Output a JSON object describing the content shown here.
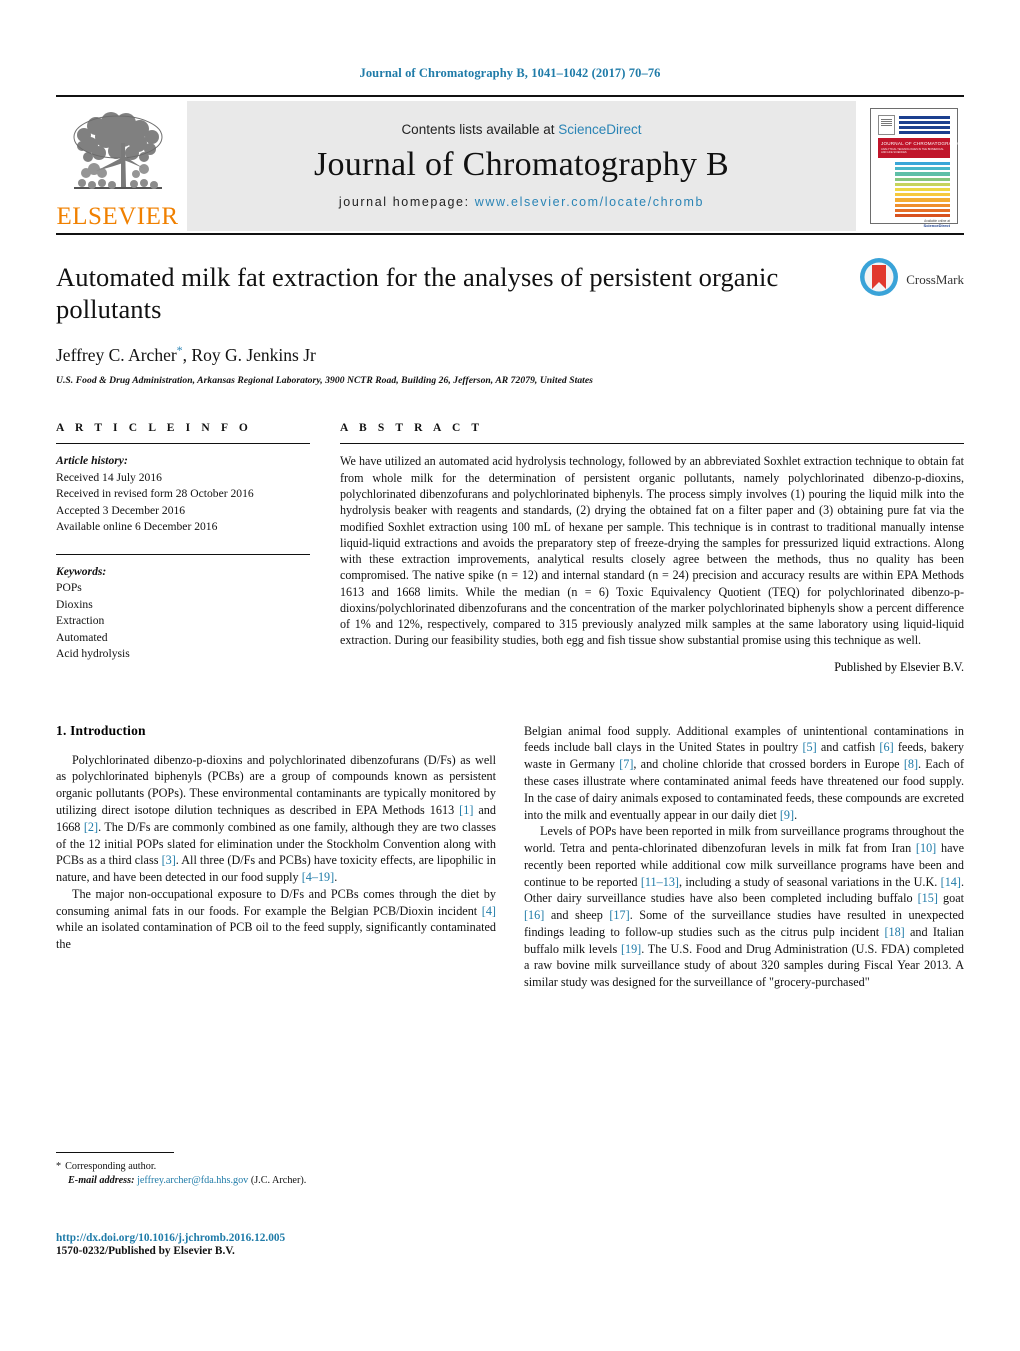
{
  "running_head": "Journal of Chromatography B, 1041–1042 (2017) 70–76",
  "masthead": {
    "contents_prefix": "Contents lists available at ",
    "sciencedirect": "ScienceDirect",
    "journal_name": "Journal of Chromatography B",
    "homepage_prefix": "journal homepage: ",
    "homepage_url": "www.elsevier.com/locate/chromb",
    "publisher_wordmark": "ELSEVIER",
    "publisher_logo_icon": "elsevier-tree-icon",
    "cover": {
      "band_title": "JOURNAL OF CHROMATOGRAPHY B",
      "band_subtitle": "ANALYTICAL TECHNOLOGIES IN THE BIOMEDICAL AND LIFE SCIENCES",
      "footer_small": "Available online at",
      "footer_brand": "ScienceDirect",
      "footer_url": "www.sciencedirect.com"
    },
    "accent_color": "#2a84b5",
    "brand_color": "#f08000",
    "cover_band_color": "#c0152a"
  },
  "article": {
    "title": "Automated milk fat extraction for the analyses of persistent organic pollutants",
    "authors": "Jeffrey C. Archer*, Roy G. Jenkins Jr",
    "author_names_plain": "Jeffrey C. Archer, Roy G. Jenkins Jr",
    "corresponding_marker": "*",
    "affiliation": "U.S. Food & Drug Administration, Arkansas Regional Laboratory, 3900 NCTR Road, Building 26, Jefferson, AR 72079, United States",
    "crossmark_label": "CrossMark",
    "crossmark_icon": "crossmark-icon"
  },
  "article_info": {
    "heading": "A R T I C L E    I N F O",
    "history_label": "Article history:",
    "history": [
      "Received 14 July 2016",
      "Received in revised form 28 October 2016",
      "Accepted 3 December 2016",
      "Available online 6 December 2016"
    ],
    "keywords_label": "Keywords:",
    "keywords": [
      "POPs",
      "Dioxins",
      "Extraction",
      "Automated",
      "Acid hydrolysis"
    ]
  },
  "abstract": {
    "heading": "A B S T R A C T",
    "text": "We have utilized an automated acid hydrolysis technology, followed by an abbreviated Soxhlet extraction technique to obtain fat from whole milk for the determination of persistent organic pollutants, namely polychlorinated dibenzo-p-dioxins, polychlorinated dibenzofurans and polychlorinated biphenyls. The process simply involves (1) pouring the liquid milk into the hydrolysis beaker with reagents and standards, (2) drying the obtained fat on a filter paper and (3) obtaining pure fat via the modified Soxhlet extraction using 100 mL of hexane per sample. This technique is in contrast to traditional manually intense liquid-liquid extractions and avoids the preparatory step of freeze-drying the samples for pressurized liquid extractions. Along with these extraction improvements, analytical results closely agree between the methods, thus no quality has been compromised. The native spike (n = 12) and internal standard (n = 24) precision and accuracy results are within EPA Methods 1613 and 1668 limits. While the median (n = 6) Toxic Equivalency Quotient (TEQ) for polychlorinated dibenzo-p-dioxins/polychlorinated dibenzofurans and the concentration of the marker polychlorinated biphenyls show a percent difference of 1% and 12%, respectively, compared to 315 previously analyzed milk samples at the same laboratory using liquid-liquid extraction. During our feasibility studies, both egg and fish tissue show substantial promise using this technique as well.",
    "published_by": "Published by Elsevier B.V."
  },
  "introduction": {
    "heading": "1. Introduction",
    "left_paragraphs": [
      "Polychlorinated dibenzo-p-dioxins and polychlorinated dibenzofurans (D/Fs) as well as polychlorinated biphenyls (PCBs) are a group of compounds known as persistent organic pollutants (POPs). These environmental contaminants are typically monitored by utilizing direct isotope dilution techniques as described in EPA Methods 1613 [1] and 1668 [2]. The D/Fs are commonly combined as one family, although they are two classes of the 12 initial POPs slated for elimination under the Stockholm Convention along with PCBs as a third class [3]. All three (D/Fs and PCBs) have toxicity effects, are lipophilic in nature, and have been detected in our food supply [4–19].",
      "The major non-occupational exposure to D/Fs and PCBs comes through the diet by consuming animal fats in our foods. For example the Belgian PCB/Dioxin incident [4] while an isolated contamination of PCB oil to the feed supply, significantly contaminated the"
    ],
    "right_paragraphs": [
      "Belgian animal food supply. Additional examples of unintentional contaminations in feeds include ball clays in the United States in poultry [5] and catfish [6] feeds, bakery waste in Germany [7], and choline chloride that crossed borders in Europe [8]. Each of these cases illustrate where contaminated animal feeds have threatened our food supply. In the case of dairy animals exposed to contaminated feeds, these compounds are excreted into the milk and eventually appear in our daily diet [9].",
      "Levels of POPs have been reported in milk from surveillance programs throughout the world. Tetra and penta-chlorinated dibenzofuran levels in milk fat from Iran [10] have recently been reported while additional cow milk surveillance programs have been and continue to be reported [11–13], including a study of seasonal variations in the U.K. [14]. Other dairy surveillance studies have also been completed including buffalo [15] goat [16] and sheep [17]. Some of the surveillance studies have resulted in unexpected findings leading to follow-up studies such as the citrus pulp incident [18] and Italian buffalo milk levels [19]. The U.S. Food and Drug Administration (U.S. FDA) completed a raw bovine milk surveillance study of about 320 samples during Fiscal Year 2013. A similar study was designed for the surveillance of \"grocery-purchased\""
    ]
  },
  "footer": {
    "corresponding_marker": "*",
    "corresponding_label": "Corresponding author.",
    "email_label": "E-mail address:",
    "email": "jeffrey.archer@fda.hhs.gov",
    "email_owner": "(J.C. Archer).",
    "doi": "http://dx.doi.org/10.1016/j.jchromb.2016.12.005",
    "issn_line": "1570-0232/Published by Elsevier B.V."
  }
}
